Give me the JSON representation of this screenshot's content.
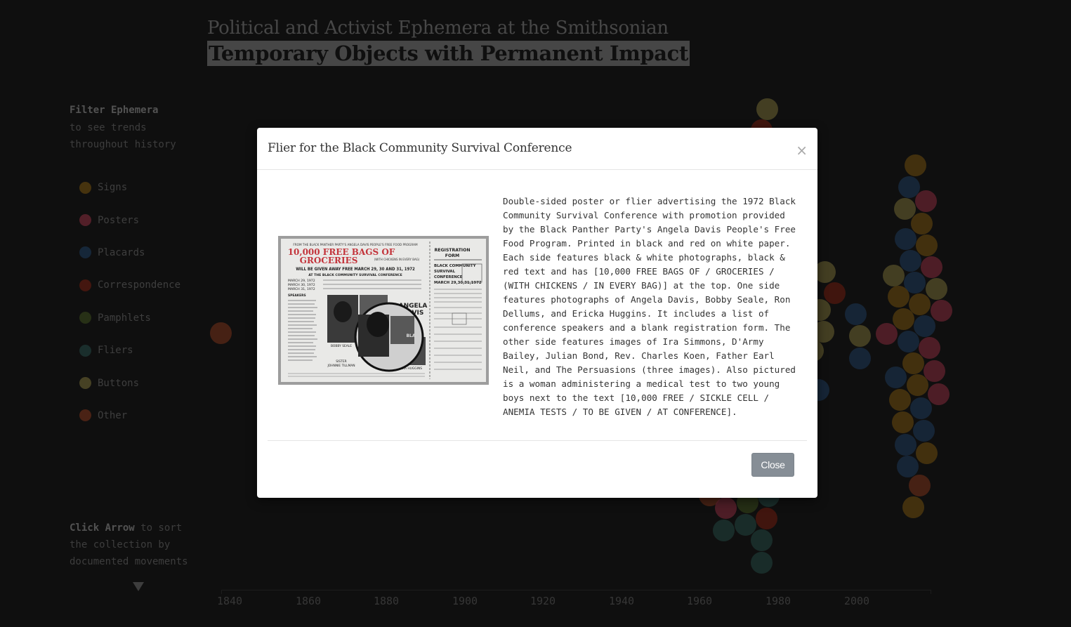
{
  "header": {
    "title": "Political and Activist Ephemera at the Smithsonian",
    "subtitle": "Temporary Objects with Permanent Impact"
  },
  "filter": {
    "heading": "Filter Ephemera",
    "subheading_line1": "to see trends",
    "subheading_line2": "throughout history",
    "items": [
      {
        "label": "Signs",
        "color": "#a7781c"
      },
      {
        "label": "Posters",
        "color": "#c6465e"
      },
      {
        "label": "Placards",
        "color": "#315a88"
      },
      {
        "label": "Correspondence",
        "color": "#a2301e"
      },
      {
        "label": "Pamphlets",
        "color": "#5b7230"
      },
      {
        "label": "Fliers",
        "color": "#3b6d66"
      },
      {
        "label": "Buttons",
        "color": "#a99c52"
      },
      {
        "label": "Other",
        "color": "#b24f2e"
      }
    ]
  },
  "sort_hint": {
    "bold": "Click Arrow",
    "line1_rest": " to sort",
    "line2": "the collection by",
    "line3": "documented movements"
  },
  "axis": {
    "ticks": [
      "1840",
      "1860",
      "1880",
      "1900",
      "1920",
      "1940",
      "1960",
      "1980",
      "2000"
    ]
  },
  "modal": {
    "title": "Flier for the Black Community Survival Conference",
    "close_x": "×",
    "description": "Double-sided poster or flier advertising the 1972 Black Community Survival Conference with promotion provided by the Black Panther Party's Angela Davis People's Free Food Program. Printed in black and red on white paper. Each side features black & white photographs, black & red text and has [10,000 FREE BAGS OF / GROCERIES / (WITH CHICKENS / IN EVERY BAG)] at the top. One side features photographs of Angela Davis, Bobby Seale, Ron Dellums, and Ericka Huggins. It includes a list of conference speakers and a blank registration form. The other side features images of Ira Simmons, D'Army Bailey, Julian Bond, Rev. Charles Koen, Father Earl Neil, and The Persuasions (three images). Also pictured is a woman administering a medical test to two young boys next to the text [10,000 FREE / SICKLE CELL / ANEMIA TESTS / TO BE GIVEN / AT CONFERENCE].",
    "close_button": "Close",
    "flier": {
      "top_line": "FROM THE BLACK PANTHER PARTY'S ANGELA DAVIS  PEOPLE'S FREE FOOD PROGRAM",
      "headline1": "10,000 FREE BAGS OF",
      "headline2": "GROCERIES",
      "with_chickens": "(WITH CHICKENS IN EVERY BAG)",
      "given_away": "WILL BE GIVEN AWAY FREE MARCH 29, 30 AND 31, 1972",
      "at_conference": "AT THE BLACK COMMUNITY SURVIVAL CONFERENCE",
      "dates": [
        "MARCH 29, 1972",
        "MARCH 30, 1972",
        "MARCH 31, 1972"
      ],
      "speakers": "SPEAKERS",
      "angela": "ANGELA",
      "davis": "DAVIS",
      "bobby": "BOBBY SEALE",
      "sister": "SISTER",
      "tillman": "JOHNNIE TILLMAN",
      "huggins": "ERICKA HUGGINS",
      "reg1": "REGISTRATION",
      "reg2": "FORM",
      "conf1": "BLACK COMMUNITY",
      "conf2": "SURVIVAL",
      "conf3": "CONFERENCE",
      "conf4": "MARCH 29,30,31,1972"
    }
  }
}
